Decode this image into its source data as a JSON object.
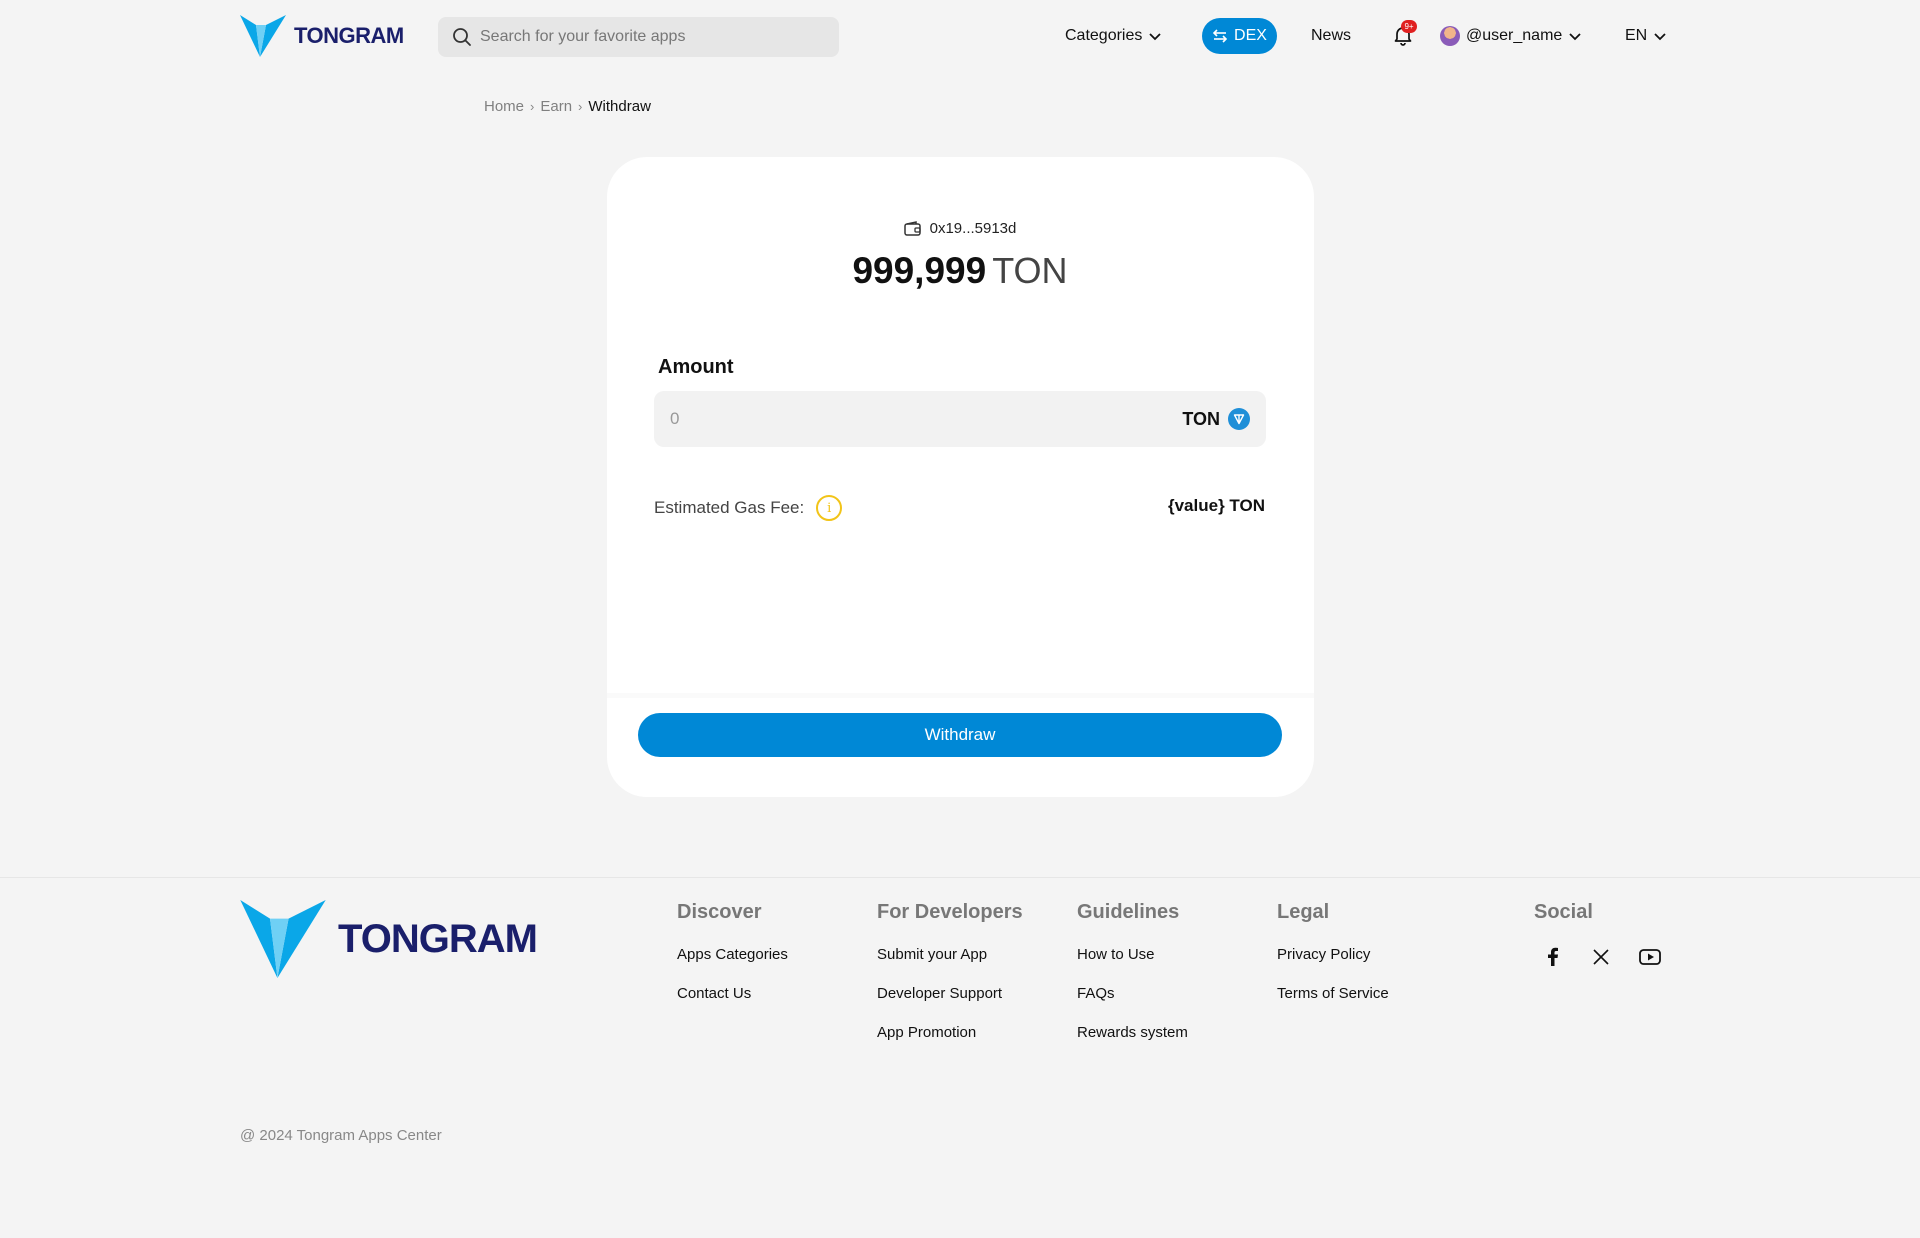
{
  "header": {
    "logo_text": "TONGRAM",
    "search_placeholder": "Search for your favorite apps",
    "categories_label": "Categories",
    "dex_label": "DEX",
    "news_label": "News",
    "notification_badge": "9+",
    "username": "@user_name",
    "language": "EN"
  },
  "breadcrumb": {
    "home": "Home",
    "earn": "Earn",
    "current": "Withdraw"
  },
  "card": {
    "wallet_address": "0x19...5913d",
    "balance_value": "999,999",
    "balance_unit": "TON",
    "amount_label": "Amount",
    "amount_placeholder": "0",
    "amount_unit": "TON",
    "gas_fee_label": "Estimated Gas Fee:",
    "gas_fee_value": "{value} TON",
    "withdraw_label": "Withdraw"
  },
  "footer": {
    "logo_text": "TONGRAM",
    "columns": [
      {
        "title": "Discover",
        "links": [
          "Apps Categories",
          "Contact Us"
        ]
      },
      {
        "title": "For Developers",
        "links": [
          "Submit your App",
          "Developer Support",
          "App Promotion"
        ]
      },
      {
        "title": "Guidelines",
        "links": [
          "How to Use",
          "FAQs",
          "Rewards system"
        ]
      },
      {
        "title": "Legal",
        "links": [
          "Privacy Policy",
          "Terms of Service"
        ]
      }
    ],
    "social_title": "Social",
    "social_icons": [
      "facebook-icon",
      "x-icon",
      "youtube-icon"
    ],
    "copyright": "@ 2024 Tongram Apps Center"
  },
  "colors": {
    "brand_blue": "#0088d6",
    "logo_navy": "#1a1f6b",
    "badge_red": "#e02020",
    "info_yellow": "#f2c418"
  }
}
